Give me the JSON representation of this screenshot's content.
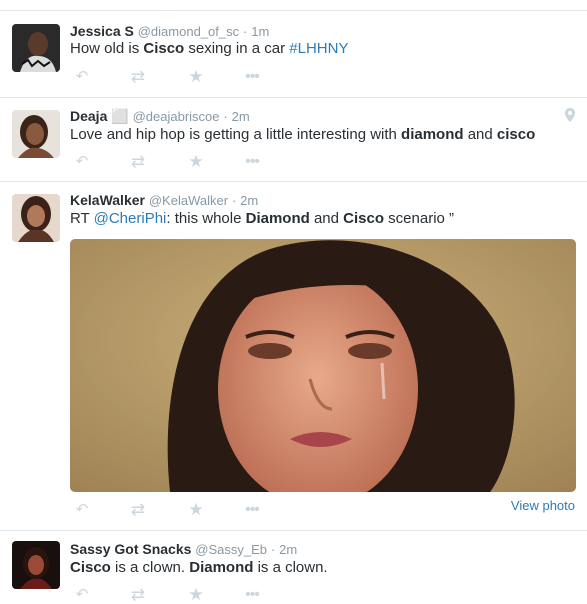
{
  "colors": {
    "link": "#2b7bb9",
    "meta": "#8899a6",
    "action_icons": "#ccd6dd",
    "divider": "#e1e8ed"
  },
  "icons": {
    "reply": "reply-icon",
    "retweet": "retweet-icon",
    "favorite": "star-icon",
    "more": "more-icon",
    "geo": "location-pin-icon"
  },
  "tweets": [
    {
      "name": "Jessica S",
      "handle": "@diamond_of_sc",
      "dot": "·",
      "time": "1m",
      "text": {
        "t1": "How old is ",
        "b1": "Cisco",
        "t2": " sexing in a car ",
        "hashtag": "#LHHNY"
      }
    },
    {
      "name": "Deaja ⬜",
      "handle": "@deajabriscoe",
      "dot": "·",
      "time": "2m",
      "text": {
        "t1": "Love and hip hop is getting a little interesting with ",
        "b1": "diamond",
        "t2": " and ",
        "b2": "cisco"
      }
    },
    {
      "name": "KelaWalker",
      "handle": "@KelaWalker",
      "dot": "·",
      "time": "2m",
      "text": {
        "t1": "RT ",
        "mention": "@CheriPhi",
        "t2": ": this whole ",
        "b1": "Diamond",
        "t3": " and ",
        "b2": "Cisco",
        "t4": " scenario  ”"
      },
      "view_photo": "View photo"
    },
    {
      "name": "Sassy Got Snacks",
      "handle": "@Sassy_Eb",
      "dot": "·",
      "time": "2m",
      "text": {
        "b1": "Cisco",
        "t1": " is a clown. ",
        "b2": "Diamond",
        "t2": " is a clown."
      }
    }
  ]
}
